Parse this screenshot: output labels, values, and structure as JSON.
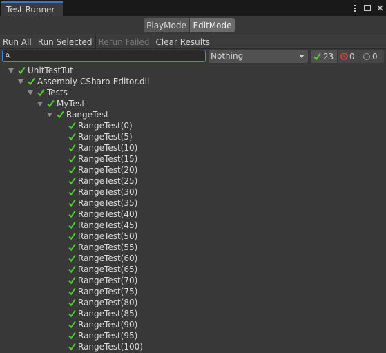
{
  "window": {
    "tab_title": "Test Runner"
  },
  "mode": {
    "play": "PlayMode",
    "edit": "EditMode"
  },
  "toolbar": {
    "run_all": "Run All",
    "run_selected": "Run Selected",
    "rerun_failed": "Rerun Failed",
    "clear_results": "Clear Results"
  },
  "search": {
    "value": "",
    "placeholder": ""
  },
  "category": {
    "selected": "Nothing"
  },
  "counters": {
    "passed": "23",
    "failed": "0",
    "skipped": "0"
  },
  "colors": {
    "pass": "#4cd226",
    "fail": "#d23a3a",
    "accent": "#3e8bd4"
  },
  "tree": {
    "root": "UnitTestTut",
    "assembly": "Assembly-CSharp-Editor.dll",
    "namespace": "Tests",
    "fixture": "MyTest",
    "method": "RangeTest",
    "cases": [
      "RangeTest(0)",
      "RangeTest(5)",
      "RangeTest(10)",
      "RangeTest(15)",
      "RangeTest(20)",
      "RangeTest(25)",
      "RangeTest(30)",
      "RangeTest(35)",
      "RangeTest(40)",
      "RangeTest(45)",
      "RangeTest(50)",
      "RangeTest(55)",
      "RangeTest(60)",
      "RangeTest(65)",
      "RangeTest(70)",
      "RangeTest(75)",
      "RangeTest(80)",
      "RangeTest(85)",
      "RangeTest(90)",
      "RangeTest(95)",
      "RangeTest(100)"
    ]
  }
}
